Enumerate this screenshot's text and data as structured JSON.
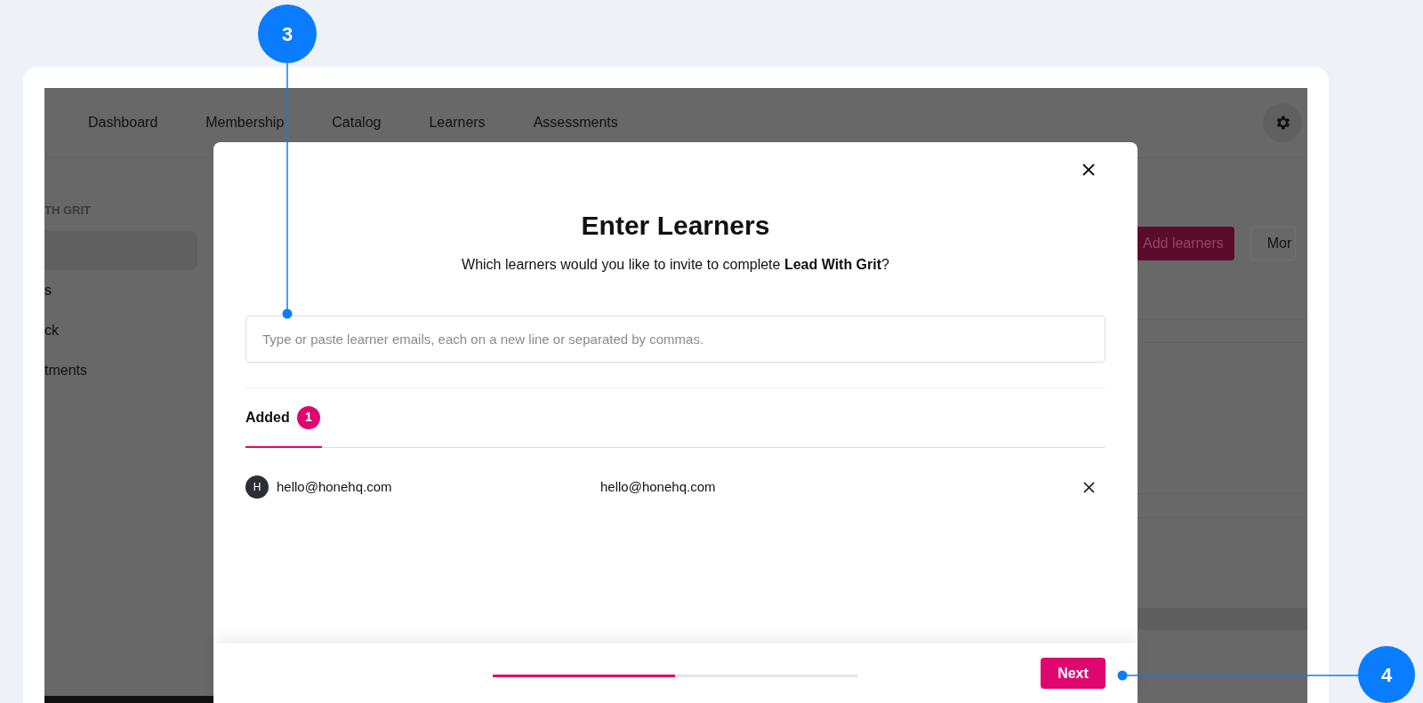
{
  "background_page": {
    "nav": [
      {
        "label": "Dashboard"
      },
      {
        "label": "Membership"
      },
      {
        "label": "Catalog"
      },
      {
        "label": "Learners"
      },
      {
        "label": "Assessments"
      }
    ],
    "sidebar": {
      "heading": "TH GRIT",
      "items": [
        {
          "selected": true
        },
        {
          "label": "s",
          "selected": false
        },
        {
          "label": "ck",
          "selected": false
        },
        {
          "label": "tments",
          "selected": false
        }
      ]
    },
    "actions": [
      {
        "label": "Add learners",
        "kind": "primary"
      },
      {
        "label": "Mor",
        "kind": "secondary"
      }
    ]
  },
  "modal": {
    "title": "Enter Learners",
    "subtitle": "Which learners would you like to invite to complete **Lead With Grit**?",
    "email_field": {
      "placeholder": "Type or paste learner emails, each on a new line or separated by commas."
    },
    "tabs": [
      {
        "label": "Added",
        "count": "1",
        "selected": true
      }
    ],
    "learners": [
      {
        "initial": "H",
        "name": "hello@honehq.com",
        "email": "hello@honehq.com"
      }
    ],
    "progress": {
      "level": 0.5
    },
    "next_button": "Next"
  },
  "callouts": [
    {
      "number": "3"
    },
    {
      "number": "4"
    }
  ]
}
